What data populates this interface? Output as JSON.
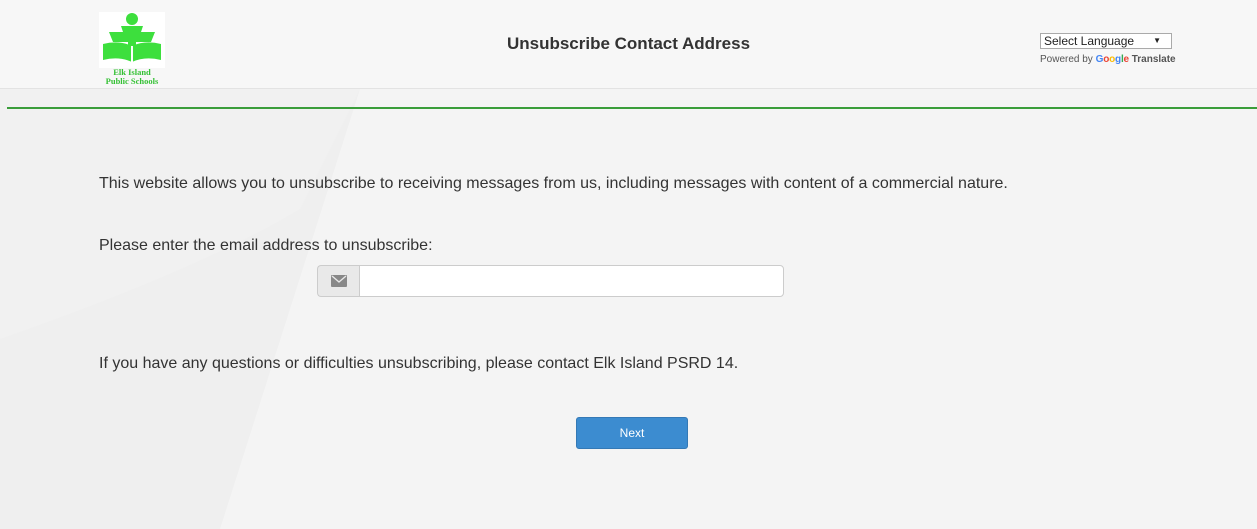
{
  "header": {
    "logo_line1": "Elk Island",
    "logo_line2": "Public Schools",
    "title": "Unsubscribe Contact Address",
    "language_select": "Select Language",
    "powered_by": "Powered by ",
    "google_letters": [
      "G",
      "o",
      "o",
      "g",
      "l",
      "e"
    ],
    "translate": "Translate"
  },
  "colors": {
    "google": [
      "#4285f4",
      "#ea4335",
      "#fbbc05",
      "#4285f4",
      "#34a853",
      "#ea4335"
    ]
  },
  "main": {
    "intro": "This website allows you to unsubscribe to receiving messages from us, including messages with content of a commercial nature.",
    "prompt": "Please enter the email address to unsubscribe:",
    "email_value": "",
    "contact": "If you have any questions or difficulties unsubscribing, please contact Elk Island PSRD 14.",
    "next_label": "Next"
  }
}
